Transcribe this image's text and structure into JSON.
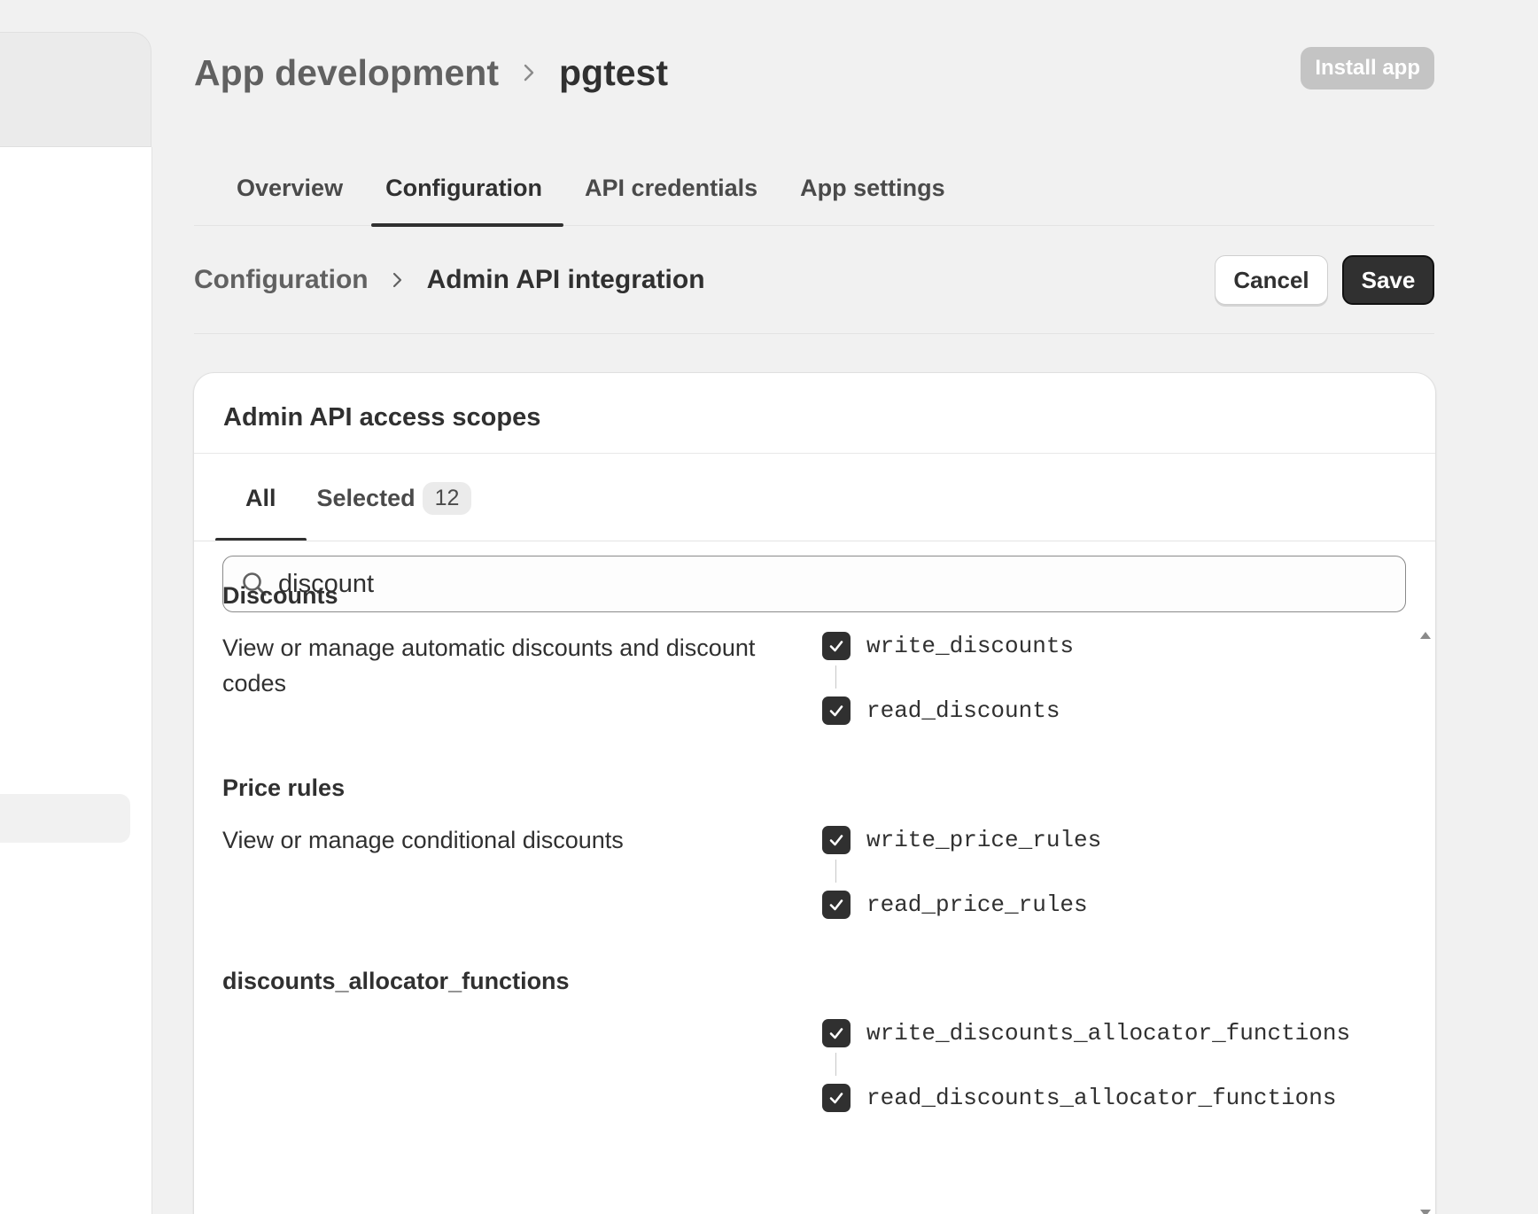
{
  "header": {
    "breadcrumb_parent": "App development",
    "breadcrumb_current": "pgtest",
    "install_label": "Install app"
  },
  "tabs": [
    {
      "label": "Overview"
    },
    {
      "label": "Configuration",
      "active": true
    },
    {
      "label": "API credentials"
    },
    {
      "label": "App settings"
    }
  ],
  "subheader": {
    "breadcrumb_parent": "Configuration",
    "breadcrumb_current": "Admin API integration",
    "cancel_label": "Cancel",
    "save_label": "Save"
  },
  "card": {
    "title": "Admin API access scopes",
    "tabs": {
      "all_label": "All",
      "selected_label": "Selected",
      "selected_count": "12"
    },
    "search": {
      "value": "discount"
    },
    "groups": [
      {
        "title": "Discounts",
        "description": "View or manage automatic discounts and discount codes",
        "scopes": [
          {
            "name": "write_discounts",
            "checked": true
          },
          {
            "name": "read_discounts",
            "checked": true
          }
        ]
      },
      {
        "title": "Price rules",
        "description": "View or manage conditional discounts",
        "scopes": [
          {
            "name": "write_price_rules",
            "checked": true
          },
          {
            "name": "read_price_rules",
            "checked": true
          }
        ]
      },
      {
        "title": "discounts_allocator_functions",
        "description": "",
        "scopes": [
          {
            "name": "write_discounts_allocator_functions",
            "checked": true
          },
          {
            "name": "read_discounts_allocator_functions",
            "checked": true
          }
        ]
      }
    ]
  },
  "colors": {
    "background": "#f1f1f1",
    "primary_button": "#303030",
    "disabled_button": "#c4c4c4"
  }
}
